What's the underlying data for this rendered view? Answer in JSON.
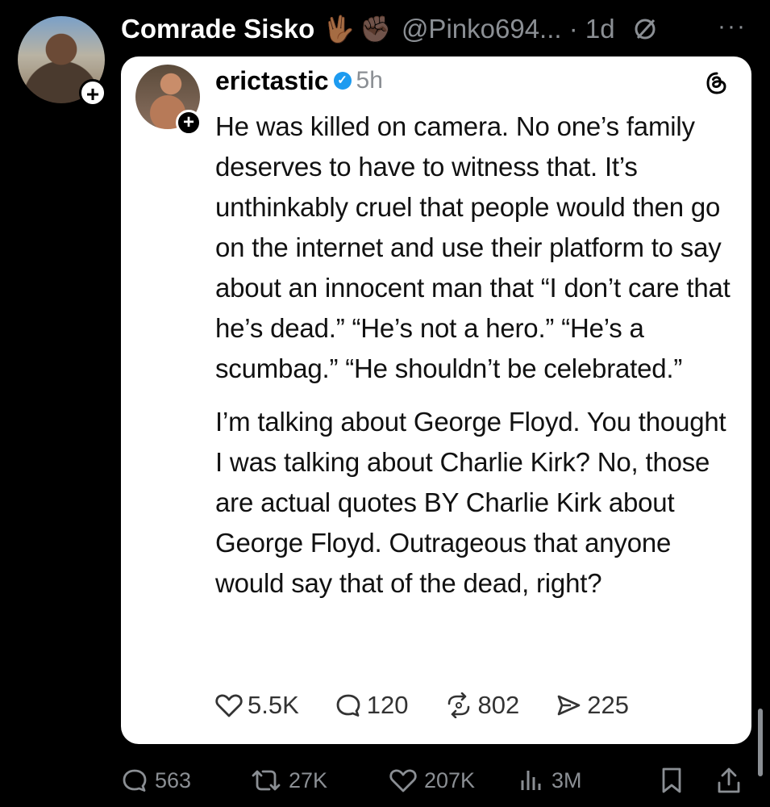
{
  "post": {
    "display_name": "Comrade Sisko",
    "emoji_1": "🖖🏾",
    "emoji_2": "✊🏿",
    "handle": "@Pinko694... · 1d",
    "more_icon": "more-dots-icon"
  },
  "quoted": {
    "username": "erictastic",
    "time": "5h",
    "paragraphs": [
      "He was killed on camera. No one’s family deserves to have to witness that. It’s unthinkably cruel that people would then go on the internet and use their platform to say about an innocent man that “I don’t care that he’s dead.” “He’s not a hero.” “He’s a scumbag.” “He shouldn’t be celebrated.”",
      "I’m talking about George Floyd. You thought I was talking about Charlie Kirk? No, those are actual quotes BY Charlie Kirk about George Floyd. Outrageous that anyone would say that of the dead, right?"
    ],
    "stats": {
      "likes": "5.5K",
      "replies": "120",
      "reposts": "802",
      "shares": "225"
    }
  },
  "actions": {
    "replies": "563",
    "reposts": "27K",
    "likes": "207K",
    "views": "3M"
  },
  "colors": {
    "background": "#000000",
    "card": "#ffffff",
    "muted": "#8b8f94",
    "verified": "#1d9bf0"
  }
}
